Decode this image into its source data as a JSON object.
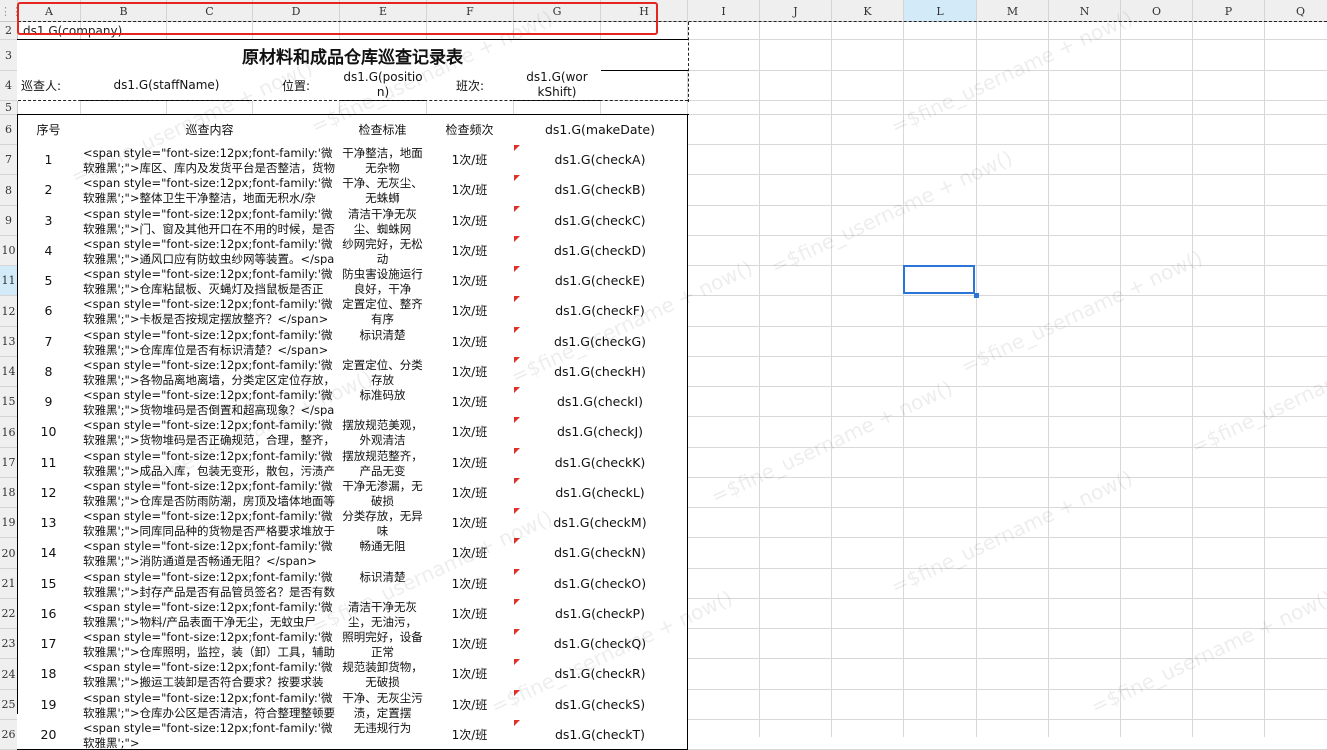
{
  "columns": [
    "A",
    "B",
    "C",
    "D",
    "E",
    "F",
    "G",
    "H",
    "I",
    "J",
    "K",
    "L",
    "M",
    "N",
    "O",
    "P",
    "Q"
  ],
  "selected_cell": "L11",
  "company": "ds1.G(company)",
  "title": "原材料和成品仓库巡查记录表",
  "info": {
    "staff_label": "巡查人:",
    "staff_value": "ds1.G(staffName)",
    "position_label": "位置:",
    "position_value": "ds1.G(position)",
    "shift_label": "班次:",
    "shift_value": "ds1.G(workShift)"
  },
  "headers": {
    "seq": "序号",
    "content": "巡查内容",
    "standard": "检查标准",
    "frequency": "检查频次",
    "date": "ds1.G(makeDate)"
  },
  "watermark": "=$fine_username + now()",
  "rows": [
    {
      "seq": "1",
      "content": "<span style=\"font-size:12px;font-family:'微软雅黑';\">库区、库内及发货平台是否整洁，货物",
      "standard": "干净整洁，地面无杂物",
      "freq": "1次/班",
      "check": "ds1.G(checkA)"
    },
    {
      "seq": "2",
      "content": "<span style=\"font-size:12px;font-family:'微软雅黑';\">整体卫生干净整洁，地面无积水/杂物，",
      "standard": "干净、无灰尘、无蛛蛳",
      "freq": "1次/班",
      "check": "ds1.G(checkB)"
    },
    {
      "seq": "3",
      "content": "<span style=\"font-size:12px;font-family:'微软雅黑';\">门、窗及其他开口在不用的时候，是否",
      "standard": "清洁干净无灰尘、蜘蛛网",
      "freq": "1次/班",
      "check": "ds1.G(checkC)"
    },
    {
      "seq": "4",
      "content": "<span style=\"font-size:12px;font-family:'微软雅黑';\">通风口应有防蚊虫纱网等装置。</span",
      "standard": "纱网完好，无松动",
      "freq": "1次/班",
      "check": "ds1.G(checkD)"
    },
    {
      "seq": "5",
      "content": "<span style=\"font-size:12px;font-family:'微软雅黑';\">仓库粘鼠板、灭蝇灯及挡鼠板是否正",
      "standard": "防虫害设施运行良好，干净",
      "freq": "1次/班",
      "check": "ds1.G(checkE)"
    },
    {
      "seq": "6",
      "content": "<span style=\"font-size:12px;font-family:'微软雅黑';\">卡板是否按规定摆放整齐？</span>",
      "standard": "定置定位、整齐有序",
      "freq": "1次/班",
      "check": "ds1.G(checkF)"
    },
    {
      "seq": "7",
      "content": "<span style=\"font-size:12px;font-family:'微软雅黑';\">仓库库位是否有标识清楚？</span>",
      "standard": "标识清楚",
      "freq": "1次/班",
      "check": "ds1.G(checkG)"
    },
    {
      "seq": "8",
      "content": "<span style=\"font-size:12px;font-family:'微软雅黑';\">各物品离地离墙，分类定区定位存放，",
      "standard": "定置定位、分类存放",
      "freq": "1次/班",
      "check": "ds1.G(checkH)"
    },
    {
      "seq": "9",
      "content": "<span style=\"font-size:12px;font-family:'微软雅黑';\">货物堆码是否倒置和超高现象？</span",
      "standard": "标准码放",
      "freq": "1次/班",
      "check": "ds1.G(checkI)"
    },
    {
      "seq": "10",
      "content": "<span style=\"font-size:12px;font-family:'微软雅黑';\">货物堆码是否正确规范，合理，整齐，",
      "standard": "摆放规范美观，外观清洁",
      "freq": "1次/班",
      "check": "ds1.G(checkJ)"
    },
    {
      "seq": "11",
      "content": "<span style=\"font-size:12px;font-family:'微软雅黑';\">成品入库，包装无变形，散包，污渍产",
      "standard": "摆放规范整齐，产品无变",
      "freq": "1次/班",
      "check": "ds1.G(checkK)"
    },
    {
      "seq": "12",
      "content": "<span style=\"font-size:12px;font-family:'微软雅黑';\">仓库是否防雨防潮，房顶及墙体地面等",
      "standard": "干净无渗漏，无破损",
      "freq": "1次/班",
      "check": "ds1.G(checkL)"
    },
    {
      "seq": "13",
      "content": "<span style=\"font-size:12px;font-family:'微软雅黑';\">同库同品种的货物是否严格要求堆放于",
      "standard": "分类存放，无异味",
      "freq": "1次/班",
      "check": "ds1.G(checkM)"
    },
    {
      "seq": "14",
      "content": "<span style=\"font-size:12px;font-family:'微软雅黑';\">消防通道是否畅通无阻？</span>",
      "standard": "畅通无阻",
      "freq": "1次/班",
      "check": "ds1.G(checkN)"
    },
    {
      "seq": "15",
      "content": "<span style=\"font-size:12px;font-family:'微软雅黑';\">封存产品是否有品管员签名？是否有数",
      "standard": "标识清楚",
      "freq": "1次/班",
      "check": "ds1.G(checkO)"
    },
    {
      "seq": "16",
      "content": "<span style=\"font-size:12px;font-family:'微软雅黑';\">物料/产品表面干净无尘，无蚊虫尸体，",
      "standard": "清洁干净无灰尘，无油污，",
      "freq": "1次/班",
      "check": "ds1.G(checkP)"
    },
    {
      "seq": "17",
      "content": "<span style=\"font-size:12px;font-family:'微软雅黑';\">仓库照明，监控，装（卸）工具，辅助",
      "standard": "照明完好，设备正常",
      "freq": "1次/班",
      "check": "ds1.G(checkQ)"
    },
    {
      "seq": "18",
      "content": "<span style=\"font-size:12px;font-family:'微软雅黑';\">搬运工装卸是否符合要求？按要求装",
      "standard": "规范装卸货物，无破损",
      "freq": "1次/班",
      "check": "ds1.G(checkR)"
    },
    {
      "seq": "19",
      "content": "<span style=\"font-size:12px;font-family:'微软雅黑';\">仓库办公区是否清洁，符合整理整顿要",
      "standard": "干净、无灰尘污渍，定置摆",
      "freq": "1次/班",
      "check": "ds1.G(checkS)"
    },
    {
      "seq": "20",
      "content": "<span style=\"font-size:12px;font-family:'微软雅黑';\">",
      "standard": "无违规行为",
      "freq": "1次/班",
      "check": "ds1.G(checkT)"
    }
  ]
}
